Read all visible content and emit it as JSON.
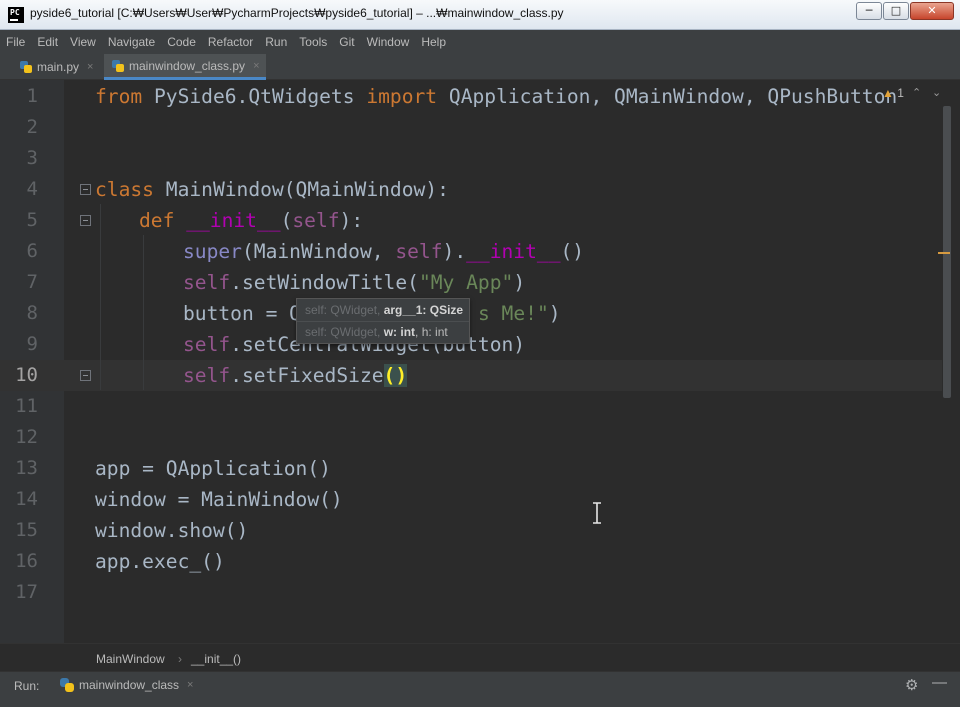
{
  "window": {
    "title": "pyside6_tutorial [C:₩Users₩User₩PycharmProjects₩pyside6_tutorial] – ...₩mainwindow_class.py",
    "app_icon": "PC",
    "controls": {
      "minimize": "─",
      "maximize": "□",
      "close": "✕"
    }
  },
  "menu": [
    "File",
    "Edit",
    "View",
    "Navigate",
    "Code",
    "Refactor",
    "Run",
    "Tools",
    "Git",
    "Window",
    "Help"
  ],
  "tabs": [
    {
      "label": "main.py",
      "close": "×",
      "active": false
    },
    {
      "label": "mainwindow_class.py",
      "close": "×",
      "active": true
    }
  ],
  "editor": {
    "line_numbers": [
      "1",
      "2",
      "3",
      "4",
      "5",
      "6",
      "7",
      "8",
      "9",
      "10",
      "11",
      "12",
      "13",
      "14",
      "15",
      "16",
      "17"
    ],
    "current_line": "10",
    "warnings": {
      "icon": "▲",
      "count": "1",
      "up": "⌃",
      "down": "⌄"
    },
    "code": {
      "l1": [
        "from",
        " PySide6.QtWidgets ",
        "import",
        " QApplication, QMainWindow, QPushButton"
      ],
      "l4": [
        "class",
        " MainWindow(QMainWindow):"
      ],
      "l5": [
        "def",
        " ",
        "__init__",
        "(",
        "self",
        "):"
      ],
      "l6": [
        "super",
        "(MainWindow, ",
        "self",
        ").",
        "__init__",
        "()"
      ],
      "l7": [
        "self",
        ".setWindowTitle(",
        "\"My App\"",
        ")"
      ],
      "l8": [
        "button = Q",
        "s Me!\"",
        ")"
      ],
      "l9": [
        "self",
        ".setCent",
        "ralWidget(button)"
      ],
      "l10": [
        "self",
        ".setFixedSize",
        "()"
      ],
      "l13": "app = QApplication()",
      "l14": "window = MainWindow()",
      "l15": "window.show()",
      "l16": "app.exec_()"
    },
    "tooltip": {
      "line1": {
        "grey": "self: QWidget, ",
        "bold": "arg__1: QSize"
      },
      "line2": {
        "grey": "self: QWidget, ",
        "bold": "w: int",
        "rest": ", h: int"
      }
    }
  },
  "breadcrumb": {
    "items": [
      "MainWindow",
      "__init__()"
    ],
    "separator": "›"
  },
  "run": {
    "label": "Run:",
    "tab": "mainwindow_class",
    "close": "×",
    "settings_icon": "⚙",
    "hide_icon": "—"
  },
  "colors": {
    "keyword": "#cc7832",
    "self": "#94558d",
    "string": "#6a8759",
    "magic": "#b200b2",
    "accent": "#4a88c7"
  }
}
